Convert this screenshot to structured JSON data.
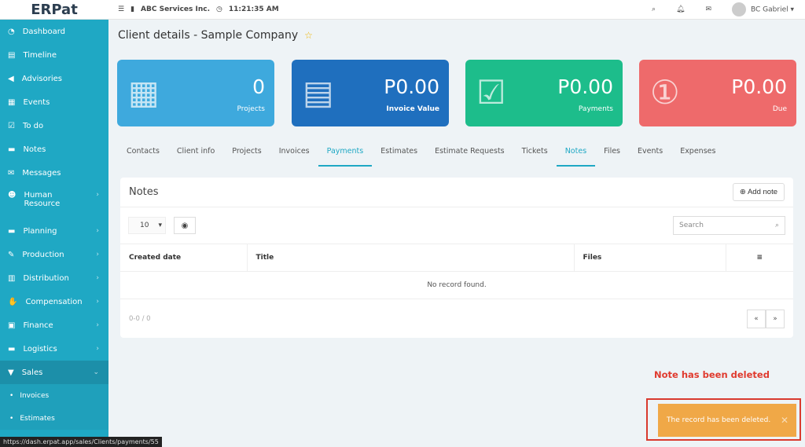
{
  "topbar": {
    "logo": "ERPat",
    "company": "ABC Services Inc.",
    "time": "11:21:35 AM",
    "user": "BC Gabriel"
  },
  "sidebar": {
    "items": [
      {
        "label": "Dashboard",
        "icon": "dashboard-icon"
      },
      {
        "label": "Timeline",
        "icon": "timeline-icon"
      },
      {
        "label": "Advisories",
        "icon": "megaphone-icon"
      },
      {
        "label": "Events",
        "icon": "calendar-icon"
      },
      {
        "label": "To do",
        "icon": "checkbox-icon"
      },
      {
        "label": "Notes",
        "icon": "note-icon"
      },
      {
        "label": "Messages",
        "icon": "envelope-icon"
      },
      {
        "label": "Human Resource",
        "icon": "users-icon"
      },
      {
        "label": "Planning",
        "icon": "briefcase-icon"
      },
      {
        "label": "Production",
        "icon": "production-icon"
      },
      {
        "label": "Distribution",
        "icon": "bank-icon"
      },
      {
        "label": "Compensation",
        "icon": "handshake-icon"
      },
      {
        "label": "Finance",
        "icon": "money-icon"
      },
      {
        "label": "Logistics",
        "icon": "truck-icon"
      },
      {
        "label": "Sales",
        "icon": "cart-icon"
      }
    ],
    "sub": [
      "Invoices",
      "Estimates"
    ]
  },
  "status_url": "https://dash.erpat.app/sales/Clients/payments/55",
  "page_title": "Client details - Sample Company",
  "cards": [
    {
      "value": "0",
      "label": "Projects",
      "color": "#3ea9dd"
    },
    {
      "value": "P0.00",
      "label": "Invoice Value",
      "color": "#1f6fbe"
    },
    {
      "value": "P0.00",
      "label": "Payments",
      "color": "#1dbd8b"
    },
    {
      "value": "P0.00",
      "label": "Due",
      "color": "#ee6a6b"
    }
  ],
  "tabs": [
    "Contacts",
    "Client info",
    "Projects",
    "Invoices",
    "Payments",
    "Estimates",
    "Estimate Requests",
    "Tickets",
    "Notes",
    "Files",
    "Events",
    "Expenses"
  ],
  "panel": {
    "title": "Notes",
    "add_label": "Add note",
    "page_size": "10",
    "search_placeholder": "Search",
    "columns": [
      "Created date",
      "Title",
      "Files"
    ],
    "empty": "No record found.",
    "range": "0-0 / 0"
  },
  "annotation": "Note has been deleted",
  "toast": "The record has been deleted."
}
